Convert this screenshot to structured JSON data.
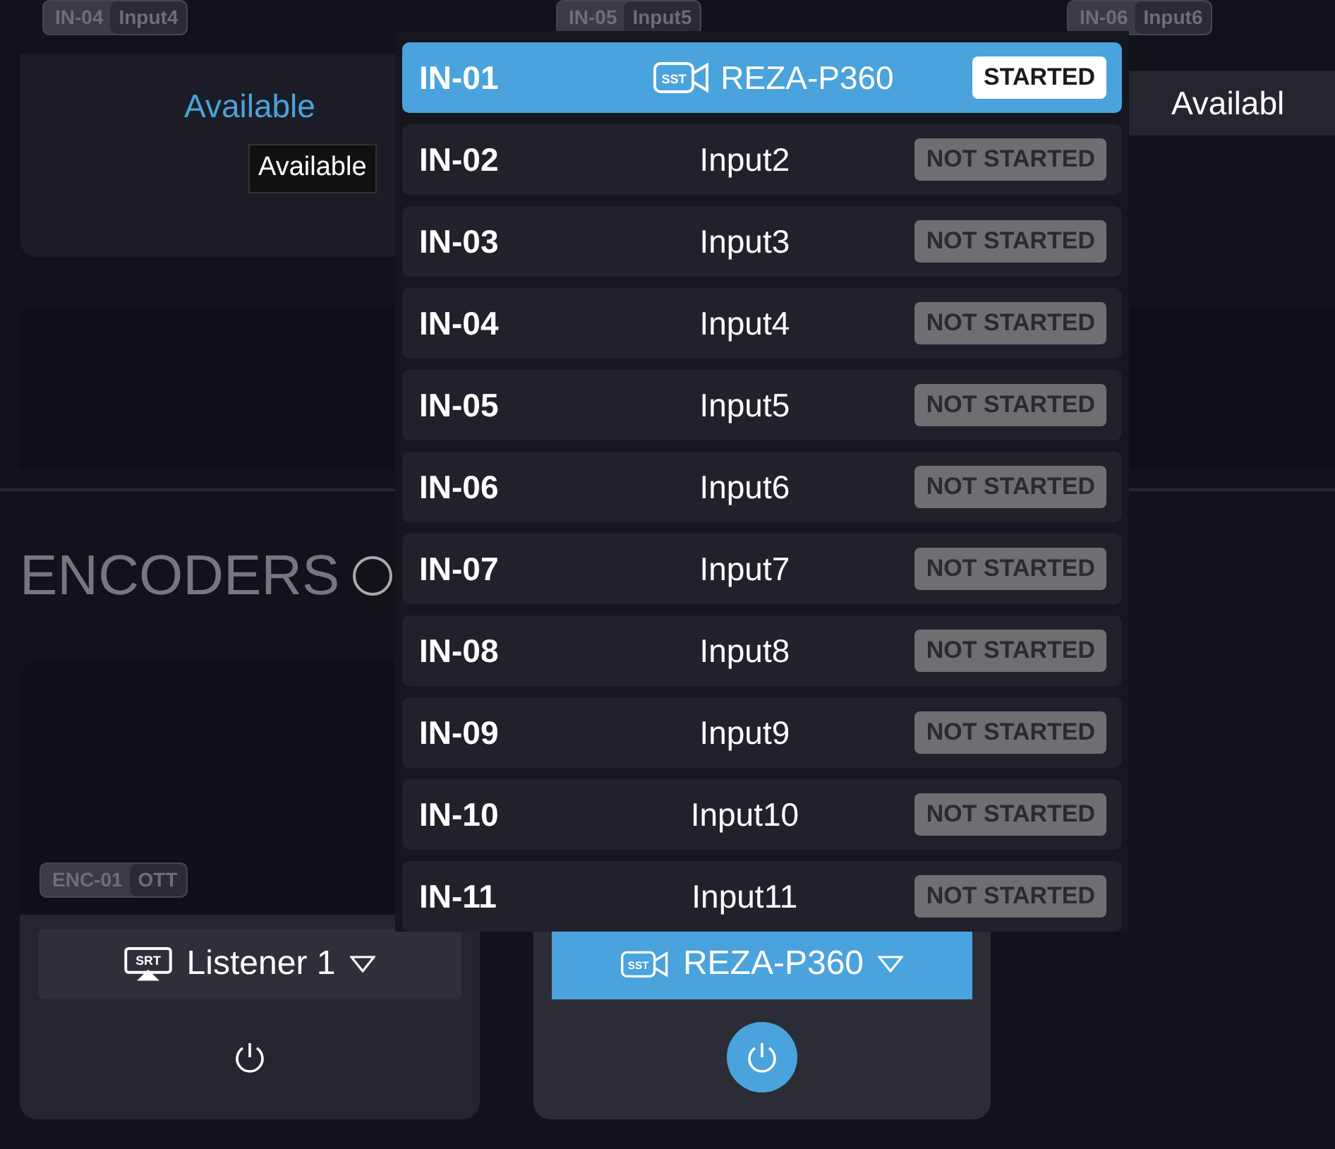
{
  "input_cards": [
    {
      "id": "IN-04",
      "name": "Input4",
      "status": "Available",
      "hovered": true
    },
    {
      "id": "IN-05",
      "name": "Input5"
    },
    {
      "id": "IN-06",
      "name": "Input6",
      "status": "Availabl",
      "hovered": false
    }
  ],
  "tooltip": "Available",
  "section_title": "ENCODERS",
  "encoders": [
    {
      "id": "ENC-01",
      "type": "OTT",
      "source": "Listener 1",
      "source_icon": {
        "kind": "srt",
        "label": "SRT"
      },
      "running": false
    },
    {
      "source": "REZA-P360",
      "source_icon": {
        "kind": "sst",
        "label": "SST"
      },
      "running": true
    }
  ],
  "dropdown": {
    "items": [
      {
        "id": "IN-01",
        "name": "REZA-P360",
        "icon": {
          "kind": "sst",
          "label": "SST"
        },
        "status": "STARTED",
        "started": true,
        "selected": true
      },
      {
        "id": "IN-02",
        "name": "Input2",
        "status": "NOT STARTED",
        "started": false,
        "selected": false
      },
      {
        "id": "IN-03",
        "name": "Input3",
        "status": "NOT STARTED",
        "started": false,
        "selected": false
      },
      {
        "id": "IN-04",
        "name": "Input4",
        "status": "NOT STARTED",
        "started": false,
        "selected": false
      },
      {
        "id": "IN-05",
        "name": "Input5",
        "status": "NOT STARTED",
        "started": false,
        "selected": false
      },
      {
        "id": "IN-06",
        "name": "Input6",
        "status": "NOT STARTED",
        "started": false,
        "selected": false
      },
      {
        "id": "IN-07",
        "name": "Input7",
        "status": "NOT STARTED",
        "started": false,
        "selected": false
      },
      {
        "id": "IN-08",
        "name": "Input8",
        "status": "NOT STARTED",
        "started": false,
        "selected": false
      },
      {
        "id": "IN-09",
        "name": "Input9",
        "status": "NOT STARTED",
        "started": false,
        "selected": false
      },
      {
        "id": "IN-10",
        "name": "Input10",
        "status": "NOT STARTED",
        "started": false,
        "selected": false
      },
      {
        "id": "IN-11",
        "name": "Input11",
        "status": "NOT STARTED",
        "started": false,
        "selected": false
      }
    ]
  }
}
